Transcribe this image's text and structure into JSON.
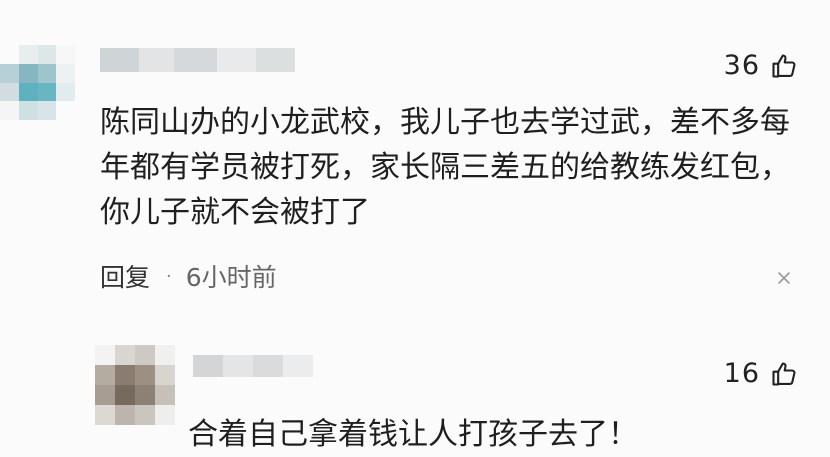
{
  "comments": [
    {
      "like_count": "36",
      "text": "陈同山办的小龙武校，我儿子也去学过武，差不多每年都有学员被打死，家长隔三差五的给教练发红包，你儿子就不会被打了",
      "reply_label": "回复",
      "separator": "·",
      "time": "6小时前",
      "icons": {
        "like": "thumbs-up-icon",
        "close": "close-icon"
      }
    },
    {
      "like_count": "16",
      "text": "合着自己拿着钱让人打孩子去了！",
      "icons": {
        "like": "thumbs-up-icon"
      }
    }
  ],
  "colors": {
    "background": "#fbfbfb",
    "text": "#1f1f1f",
    "meta": "#666666"
  }
}
